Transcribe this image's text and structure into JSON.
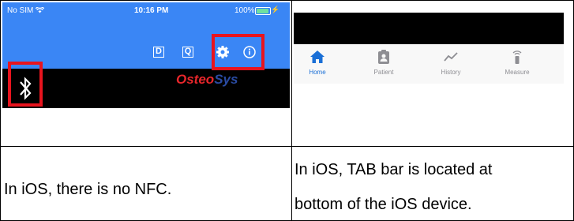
{
  "left_screenshot": {
    "status_bar": {
      "carrier": "No SIM",
      "time": "10:16 PM",
      "battery": "100%"
    },
    "toolbar": {
      "d_label": "D",
      "q_label": "Q",
      "icons": [
        "gear-icon",
        "info-icon"
      ]
    },
    "brand": {
      "part_a": "Osteo",
      "part_b": "Sys"
    },
    "highlight_color": "#e8141e",
    "accent_color": "#3a86f5"
  },
  "right_screenshot": {
    "tabs": [
      {
        "label": "Home",
        "icon": "home-icon",
        "active": true
      },
      {
        "label": "Patient",
        "icon": "patient-icon",
        "active": false
      },
      {
        "label": "History",
        "icon": "history-icon",
        "active": false
      },
      {
        "label": "Measure",
        "icon": "measure-icon",
        "active": false
      }
    ],
    "active_color": "#1a6fd6"
  },
  "captions": {
    "left": "In iOS, there is no NFC.",
    "right_line1": "In iOS, TAB bar is located at",
    "right_line2": "bottom of the iOS device."
  }
}
